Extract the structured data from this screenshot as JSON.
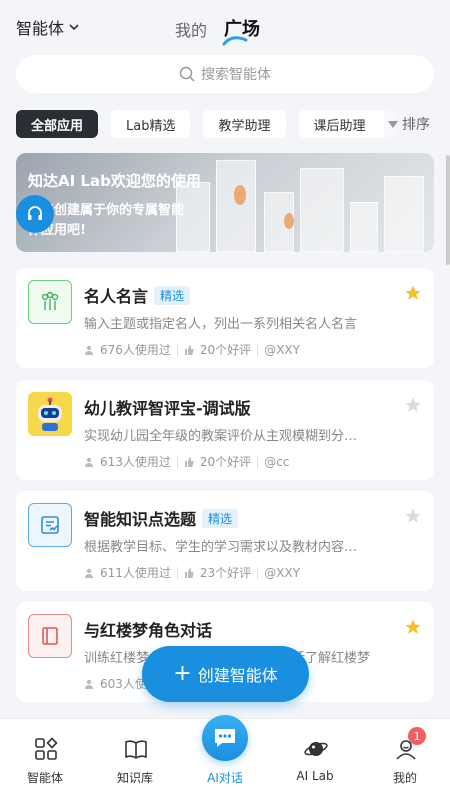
{
  "header": {
    "left_label": "智能体",
    "tab_mine": "我的",
    "tab_square": "广场"
  },
  "search": {
    "placeholder": "搜索智能体"
  },
  "filters": {
    "chips": [
      "全部应用",
      "Lab精选",
      "教学助理",
      "课后助理"
    ],
    "sort_label": "排序"
  },
  "banner": {
    "title": "知达AI Lab欢迎您的使用",
    "subtitle": "快来创建属于你的专属智能体应用吧!"
  },
  "cards": [
    {
      "title": "名人名言",
      "tag": "精选",
      "desc": "输入主题或指定名人，列出一系列相关名人名言",
      "users": "676人使用过",
      "likes": "20个好评",
      "author": "@XXY",
      "starred": true
    },
    {
      "title": "幼儿教评智评宝-调试版",
      "tag": "",
      "desc": "实现幼儿园全年级的教案评价从主观模糊到分…",
      "users": "613人使用过",
      "likes": "20个好评",
      "author": "@cc",
      "starred": false
    },
    {
      "title": "智能知识点选题",
      "tag": "精选",
      "desc": "根据教学目标、学生的学习需求以及教材内容…",
      "users": "611人使用过",
      "likes": "23个好评",
      "author": "@XXY",
      "starred": false
    },
    {
      "title": "与红楼梦角色对话",
      "tag": "",
      "desc": "训练红楼梦角色对话智能体，通过对话了解红楼梦",
      "users": "603人使用过",
      "likes": "",
      "author": "",
      "starred": true
    }
  ],
  "create_button": {
    "label": "创建智能体"
  },
  "bottom_nav": [
    {
      "label": "智能体",
      "icon": "agent-grid-icon"
    },
    {
      "label": "知识库",
      "icon": "book-icon"
    },
    {
      "label": "AI对话",
      "icon": "chat-bubble-icon"
    },
    {
      "label": "AI Lab",
      "icon": "planet-icon"
    },
    {
      "label": "我的",
      "icon": "profile-icon",
      "badge": "1"
    }
  ],
  "colors": {
    "accent": "#1a8fe0",
    "star": "#f5c02a",
    "badge": "#f06060"
  }
}
